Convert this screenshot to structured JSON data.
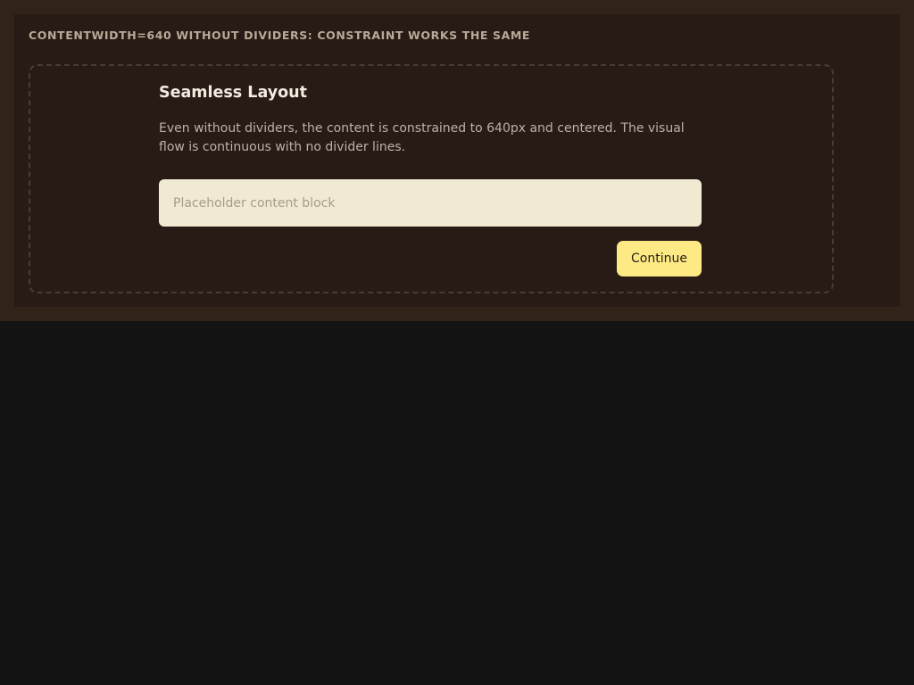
{
  "section": {
    "caption": "CONTENTWIDTH=640 WITHOUT DIVIDERS: CONSTRAINT WORKS THE SAME"
  },
  "card": {
    "title": "Seamless Layout",
    "description": "Even without dividers, the content is constrained to 640px and centered. The visual flow is continuous with no divider lines.",
    "placeholder_text": "Placeholder content block",
    "continue_label": "Continue"
  },
  "colors": {
    "page_background": "#131313",
    "outer_band": "#31231a",
    "panel_background": "#281a14",
    "frame_border": "#4b3b30",
    "title_text": "#f3ece1",
    "body_text": "#bdb2a6",
    "placeholder_background": "#f0ead3",
    "accent_button": "#fdea85"
  }
}
